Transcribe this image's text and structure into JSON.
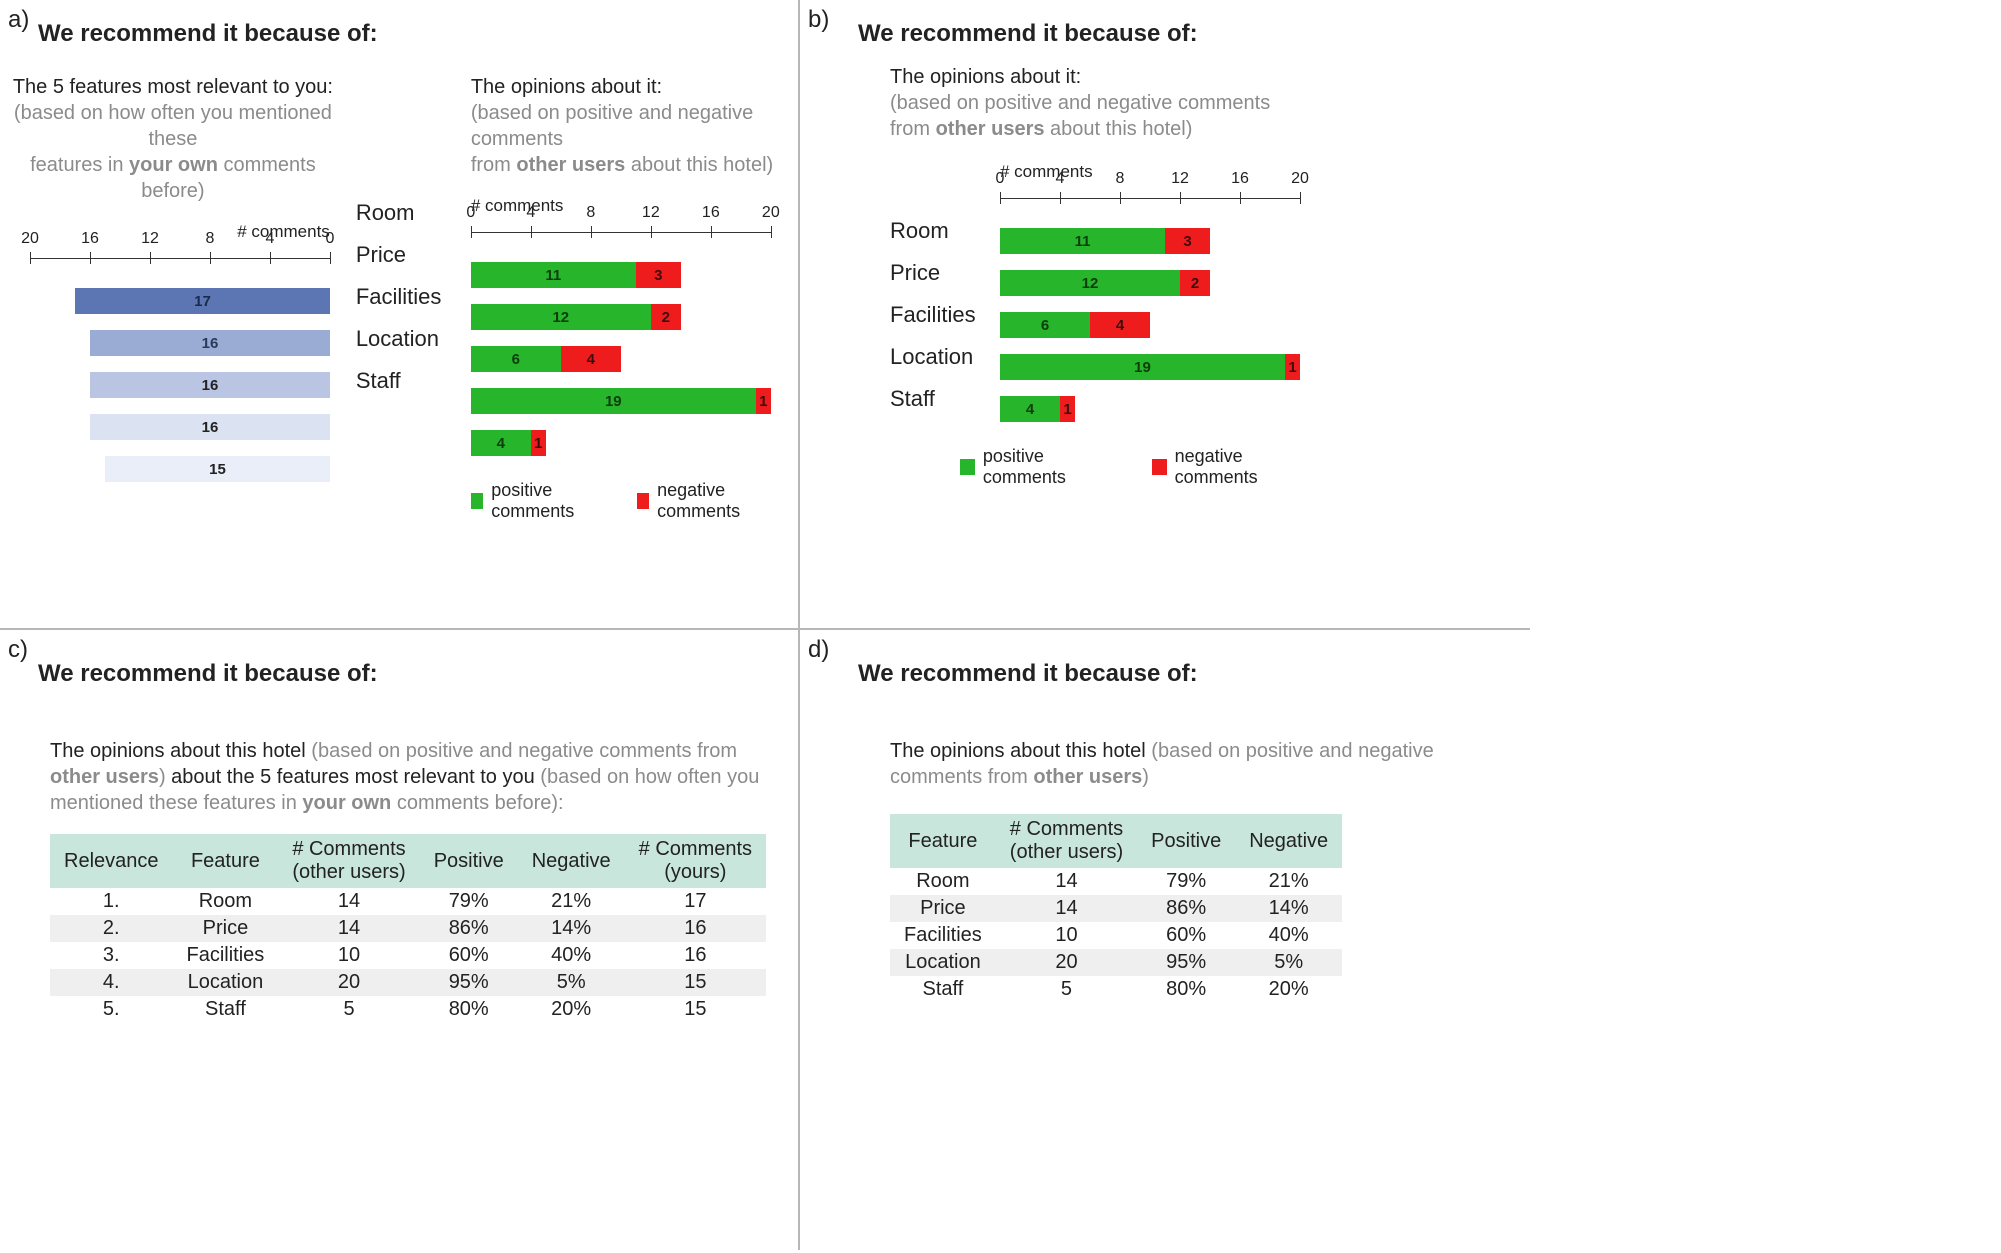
{
  "letters": {
    "a": "a)",
    "b": "b)",
    "c": "c)",
    "d": "d)"
  },
  "heading": "We recommend it because of:",
  "relevance_sub": {
    "line1_dark": "The 5 features most relevant to you:",
    "line2_grey": "(based on how often you mentioned  these",
    "line3_grey_pre": "features in ",
    "line3_bold": "your own",
    "line3_grey_post": " comments before)"
  },
  "opinions_sub": {
    "line1_dark": "The opinions about it:",
    "line2_grey": "(based on positive and negative comments",
    "line3_grey_pre": "from ",
    "line3_bold": "other users",
    "line3_grey_post": " about this hotel)"
  },
  "table_c_sub": {
    "dark1": "The opinions about this hotel ",
    "grey1": "(based on positive and negative comments from ",
    "bold1": "other users",
    "grey1b": ") ",
    "dark2": "about the 5 features most relevant to you ",
    "grey2": "(based on how often you mentioned these features in ",
    "bold2": "your own",
    "grey2b": " comments before):"
  },
  "table_d_sub": {
    "dark1": "The opinions about this hotel ",
    "grey1": "(based on positive and negative comments from ",
    "bold1": "other users",
    "grey1b": ")"
  },
  "axis_label": "# comments",
  "legend": {
    "positive": "positive comments",
    "negative": "negative comments"
  },
  "categories": [
    "Room",
    "Price",
    "Facilities",
    "Location",
    "Staff"
  ],
  "chart_data": [
    {
      "id": "panel_a_left",
      "type": "bar",
      "orientation": "horizontal-reversed",
      "xlabel": "# comments",
      "xlim": [
        0,
        20
      ],
      "ticks": [
        20,
        16,
        12,
        8,
        4,
        0
      ],
      "categories": [
        "Room",
        "Price",
        "Facilities",
        "Location",
        "Staff"
      ],
      "values": [
        17,
        16,
        16,
        16,
        15
      ],
      "bar_colors": [
        "#5b76b3",
        "#9aabd4",
        "#b9c5e3",
        "#dbe3f2",
        "#e9eef8"
      ]
    },
    {
      "id": "panel_a_right",
      "type": "stacked-bar",
      "orientation": "horizontal",
      "xlabel": "# comments",
      "xlim": [
        0,
        20
      ],
      "ticks": [
        0,
        4,
        8,
        12,
        16,
        20
      ],
      "categories": [
        "Room",
        "Price",
        "Facilities",
        "Location",
        "Staff"
      ],
      "series": [
        {
          "name": "positive",
          "color": "#27b52b",
          "values": [
            11,
            12,
            6,
            19,
            4
          ]
        },
        {
          "name": "negative",
          "color": "#ee1c1c",
          "values": [
            3,
            2,
            4,
            1,
            1
          ]
        }
      ]
    },
    {
      "id": "panel_b",
      "type": "stacked-bar",
      "orientation": "horizontal",
      "xlabel": "# comments",
      "xlim": [
        0,
        20
      ],
      "ticks": [
        0,
        4,
        8,
        12,
        16,
        20
      ],
      "categories": [
        "Room",
        "Price",
        "Facilities",
        "Location",
        "Staff"
      ],
      "series": [
        {
          "name": "positive",
          "color": "#27b52b",
          "values": [
            11,
            12,
            6,
            19,
            4
          ]
        },
        {
          "name": "negative",
          "color": "#ee1c1c",
          "values": [
            3,
            2,
            4,
            1,
            1
          ]
        }
      ]
    },
    {
      "id": "panel_c_table",
      "type": "table",
      "columns": [
        "Relevance",
        "Feature",
        "# Comments (other users)",
        "Positive",
        "Negative",
        "# Comments (yours)"
      ],
      "rows": [
        [
          "1.",
          "Room",
          "14",
          "79%",
          "21%",
          "17"
        ],
        [
          "2.",
          "Price",
          "14",
          "86%",
          "14%",
          "16"
        ],
        [
          "3.",
          "Facilities",
          "10",
          "60%",
          "40%",
          "16"
        ],
        [
          "4.",
          "Location",
          "20",
          "95%",
          "5%",
          "15"
        ],
        [
          "5.",
          "Staff",
          "5",
          "80%",
          "20%",
          "15"
        ]
      ]
    },
    {
      "id": "panel_d_table",
      "type": "table",
      "columns": [
        "Feature",
        "# Comments (other users)",
        "Positive",
        "Negative"
      ],
      "rows": [
        [
          "Room",
          "14",
          "79%",
          "21%"
        ],
        [
          "Price",
          "14",
          "86%",
          "14%"
        ],
        [
          "Facilities",
          "10",
          "60%",
          "40%"
        ],
        [
          "Location",
          "20",
          "95%",
          "5%"
        ],
        [
          "Staff",
          "5",
          "80%",
          "20%"
        ]
      ]
    }
  ],
  "table_c": {
    "headers": {
      "relevance": "Relevance",
      "feature": "Feature",
      "comments_other_line1": "# Comments",
      "comments_other_line2": "(other users)",
      "positive": "Positive",
      "negative": "Negative",
      "comments_yours_line1": "# Comments",
      "comments_yours_line2": "(yours)"
    },
    "rows": [
      {
        "rel": "1.",
        "feature": "Room",
        "co": "14",
        "pos": "79%",
        "neg": "21%",
        "cy": "17"
      },
      {
        "rel": "2.",
        "feature": "Price",
        "co": "14",
        "pos": "86%",
        "neg": "14%",
        "cy": "16"
      },
      {
        "rel": "3.",
        "feature": "Facilities",
        "co": "10",
        "pos": "60%",
        "neg": "40%",
        "cy": "16"
      },
      {
        "rel": "4.",
        "feature": "Location",
        "co": "20",
        "pos": "95%",
        "neg": "5%",
        "cy": "15"
      },
      {
        "rel": "5.",
        "feature": "Staff",
        "co": "5",
        "pos": "80%",
        "neg": "20%",
        "cy": "15"
      }
    ]
  },
  "table_d": {
    "headers": {
      "feature": "Feature",
      "comments_other_line1": "# Comments",
      "comments_other_line2": "(other users)",
      "positive": "Positive",
      "negative": "Negative"
    },
    "rows": [
      {
        "feature": "Room",
        "co": "14",
        "pos": "79%",
        "neg": "21%"
      },
      {
        "feature": "Price",
        "co": "14",
        "pos": "86%",
        "neg": "14%"
      },
      {
        "feature": "Facilities",
        "co": "10",
        "pos": "60%",
        "neg": "40%"
      },
      {
        "feature": "Location",
        "co": "20",
        "pos": "95%",
        "neg": "5%"
      },
      {
        "feature": "Staff",
        "co": "5",
        "pos": "80%",
        "neg": "20%"
      }
    ]
  }
}
